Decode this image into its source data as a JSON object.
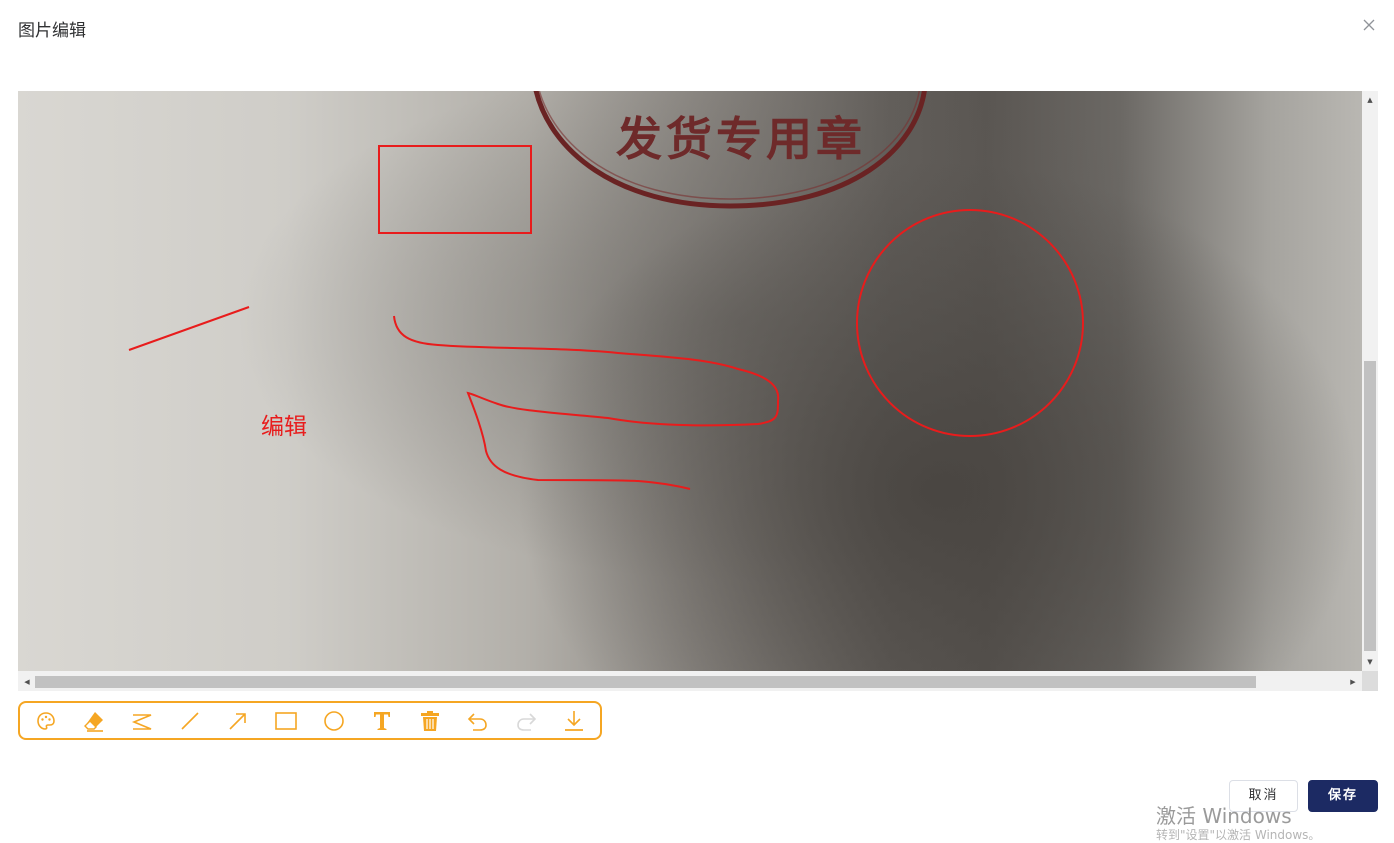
{
  "dialog": {
    "title": "图片编辑"
  },
  "canvas": {
    "stamp_text": "发货专用章",
    "annotation_text": "编辑",
    "annotation_color": "#e81c1c"
  },
  "toolbar": {
    "accent_color": "#f5a623",
    "tools": [
      {
        "name": "palette-icon"
      },
      {
        "name": "eraser-icon"
      },
      {
        "name": "freehand-icon"
      },
      {
        "name": "line-icon"
      },
      {
        "name": "arrow-icon"
      },
      {
        "name": "rectangle-icon"
      },
      {
        "name": "circle-icon"
      },
      {
        "name": "text-icon"
      },
      {
        "name": "trash-icon"
      },
      {
        "name": "undo-icon"
      },
      {
        "name": "redo-icon"
      },
      {
        "name": "download-icon"
      }
    ]
  },
  "footer": {
    "cancel_label": "取消",
    "save_label": "保存",
    "save_color": "#1c2a63"
  },
  "watermark": {
    "text": "激活 Windows",
    "sub": "转到\"设置\"以激活 Windows。"
  }
}
